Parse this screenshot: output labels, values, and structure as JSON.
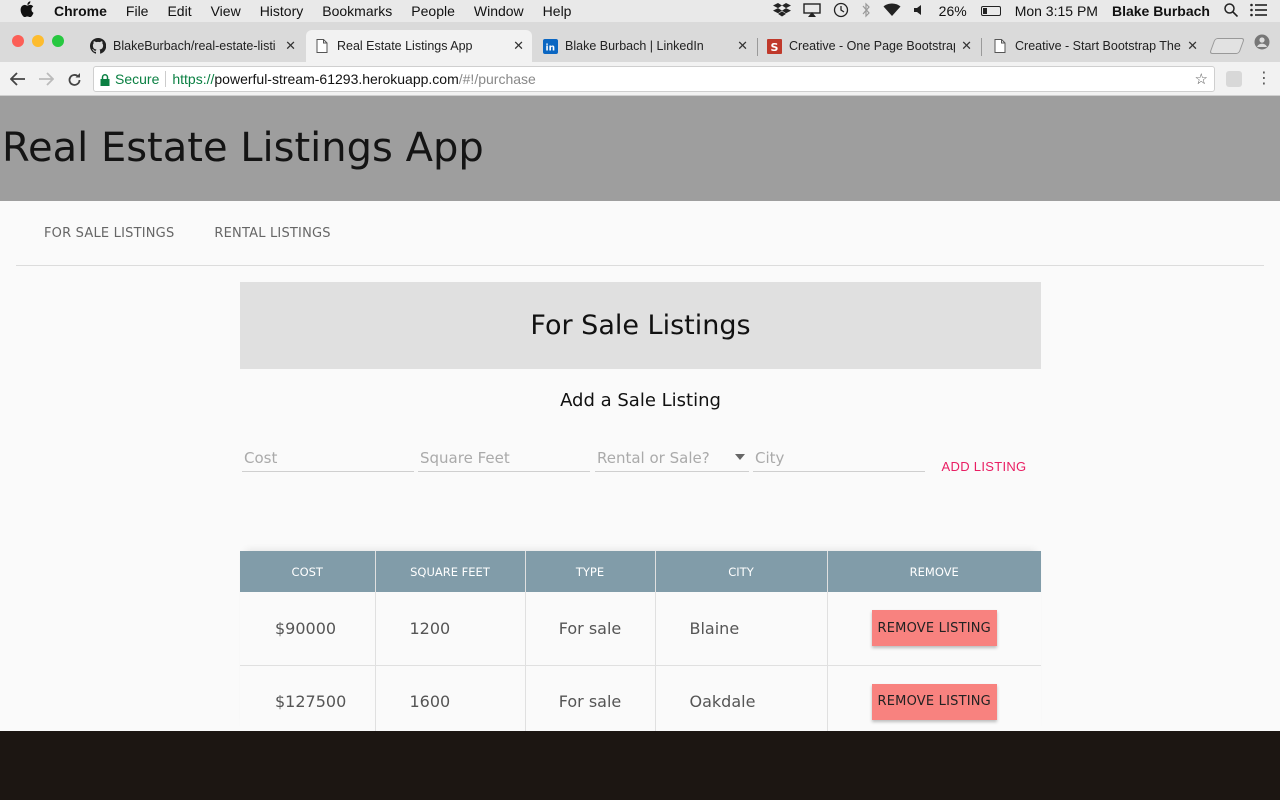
{
  "menubar": {
    "app_name": "Chrome",
    "items": [
      "File",
      "Edit",
      "View",
      "History",
      "Bookmarks",
      "People",
      "Window",
      "Help"
    ],
    "battery_percent": "26%",
    "battery_level": 0.26,
    "clock": "Mon 3:15 PM",
    "user": "Blake Burbach"
  },
  "tabs": [
    {
      "title": "BlakeBurbach/real-estate-listi",
      "icon": "github-icon",
      "active": false
    },
    {
      "title": "Real Estate Listings App",
      "icon": "page-icon",
      "active": true
    },
    {
      "title": "Blake Burbach | LinkedIn",
      "icon": "linkedin-icon",
      "active": false
    },
    {
      "title": "Creative - One Page Bootstrap",
      "icon": "s-logo-icon",
      "active": false
    },
    {
      "title": "Creative - Start Bootstrap The",
      "icon": "page-icon",
      "active": false
    }
  ],
  "address_bar": {
    "secure_label": "Secure",
    "url_scheme": "https://",
    "url_host": "powerful-stream-61293.herokuapp.com",
    "url_path": "/#!/purchase"
  },
  "page": {
    "app_title": "Real Estate Listings App",
    "nav": [
      "FOR SALE LISTINGS",
      "RENTAL LISTINGS"
    ],
    "section_title": "For Sale Listings",
    "form_title": "Add a Sale Listing",
    "form": {
      "cost_placeholder": "Cost",
      "sqft_placeholder": "Square Feet",
      "type_placeholder": "Rental or Sale?",
      "city_placeholder": "City",
      "add_label": "ADD LISTING"
    },
    "table": {
      "headers": [
        "COST",
        "SQUARE FEET",
        "TYPE",
        "CITY",
        "REMOVE"
      ],
      "rows": [
        {
          "cost": "$90000",
          "sqft": "1200",
          "type": "For sale",
          "city": "Blaine",
          "action": "REMOVE LISTING"
        },
        {
          "cost": "$127500",
          "sqft": "1600",
          "type": "For sale",
          "city": "Oakdale",
          "action": "REMOVE LISTING"
        }
      ]
    }
  },
  "colors": {
    "hero_bg": "#9e9e9e",
    "table_header_bg": "#819ca9",
    "accent_pink": "#e91e63",
    "remove_button_bg": "#f8827f"
  }
}
